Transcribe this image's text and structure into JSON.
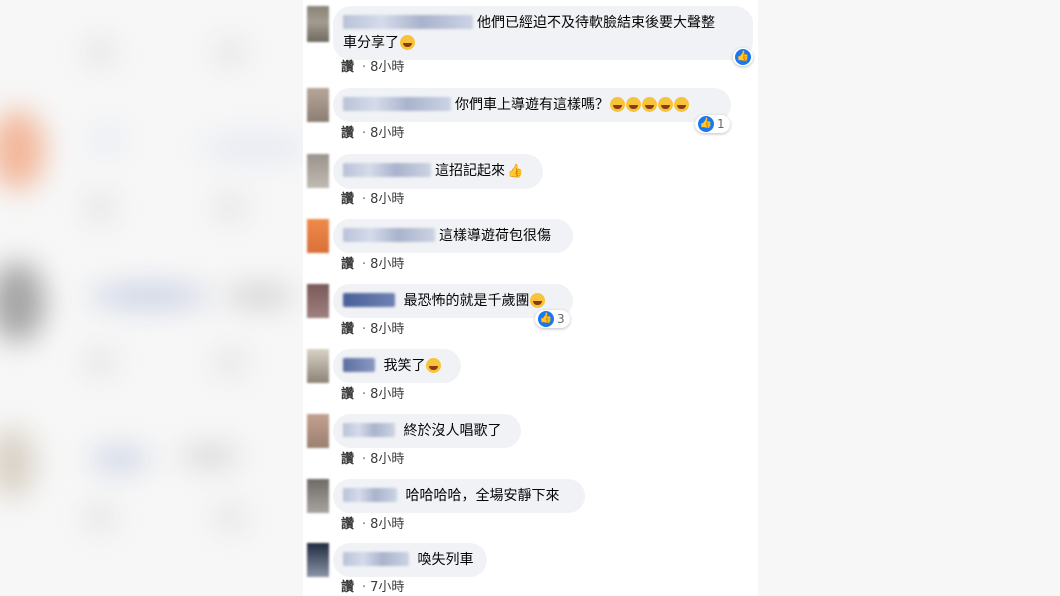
{
  "like_label": "讚",
  "comments": [
    {
      "text_l1": "他們已經迫不及待軟臉結束後要大聲整",
      "text_l2": "車分享了",
      "emoji_count": 1,
      "time": "8小時",
      "reactions": null
    },
    {
      "text": "你們車上導遊有這樣嗎？",
      "emoji_count": 5,
      "time": "8小時",
      "reactions": "1"
    },
    {
      "text": "這招記起來",
      "thumb": "👍",
      "time": "8小時",
      "reactions": null
    },
    {
      "text": "這樣導遊荷包很傷",
      "time": "8小時",
      "reactions": null
    },
    {
      "text": "最恐怖的就是千歲團",
      "emoji_count": 1,
      "time": "8小時",
      "reactions": "3"
    },
    {
      "text": "我笑了",
      "emoji_count": 1,
      "time": "8小時",
      "reactions": null
    },
    {
      "text": "終於沒人唱歌了",
      "time": "8小時",
      "reactions": null
    },
    {
      "text": "哈哈哈哈，全場安靜下來",
      "time": "8小時",
      "reactions": null
    },
    {
      "text": "喚失列車",
      "time": "7小時",
      "reactions": null
    }
  ],
  "colors": {
    "bubble": "#f0f2f5",
    "like_blue": "#1877f2",
    "emoji": "#f7c33c"
  }
}
